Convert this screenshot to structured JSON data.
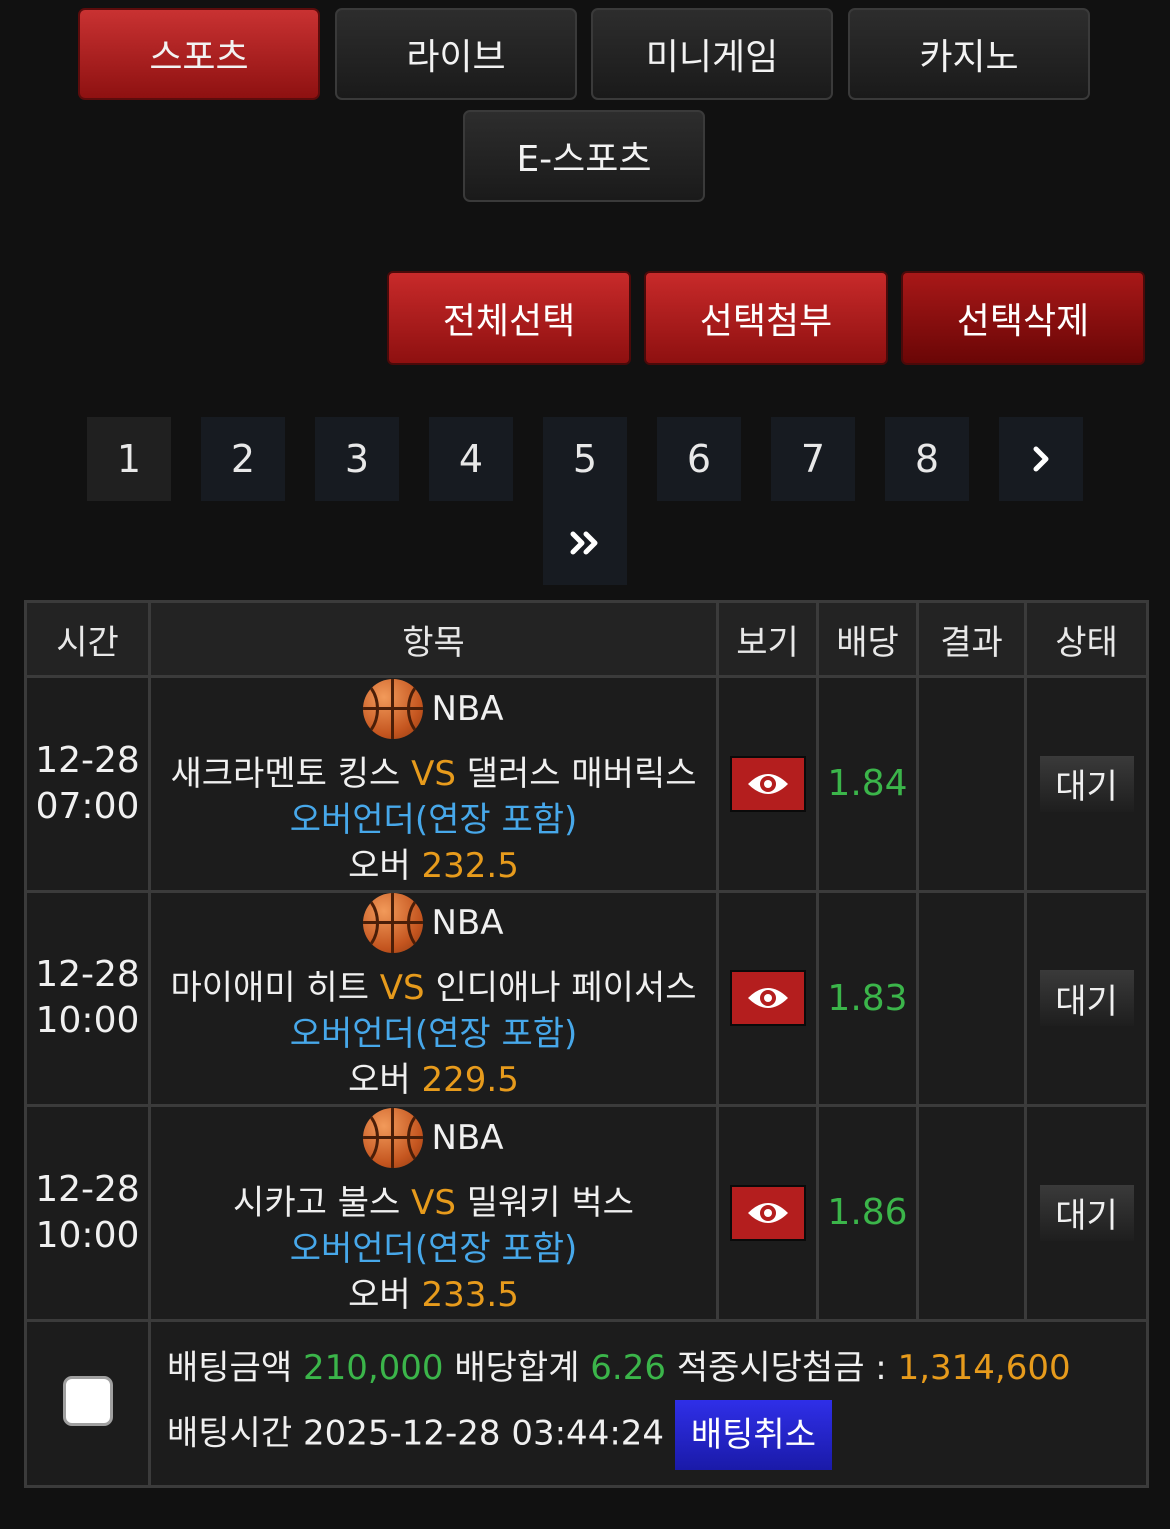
{
  "tabs": [
    {
      "label": "스포츠",
      "active": true
    },
    {
      "label": "라이브",
      "active": false
    },
    {
      "label": "미니게임",
      "active": false
    },
    {
      "label": "카지노",
      "active": false
    },
    {
      "label": "E-스포츠",
      "active": false
    }
  ],
  "actions": {
    "select_all": "전체선택",
    "attach_selected": "선택첨부",
    "delete_selected": "선택삭제"
  },
  "pagination": {
    "pages": [
      "1",
      "2",
      "3",
      "4",
      "5",
      "6",
      "7",
      "8"
    ],
    "current": "1",
    "next_icon": "chevron-right-icon",
    "last_icon": "double-chevron-right-icon"
  },
  "table": {
    "headers": {
      "time": "시간",
      "item": "항목",
      "view": "보기",
      "odds": "배당",
      "result": "결과",
      "status": "상태"
    },
    "rows": [
      {
        "date": "12-28",
        "time": "07:00",
        "league": "NBA",
        "home": "새크라멘토 킹스",
        "vs": "VS",
        "away": "댈러스 매버릭스",
        "market": "오버언더(연장 포함)",
        "pick": "오버",
        "line": "232.5",
        "odds": "1.84",
        "result": "",
        "status": "대기"
      },
      {
        "date": "12-28",
        "time": "10:00",
        "league": "NBA",
        "home": "마이애미 히트",
        "vs": "VS",
        "away": "인디애나 페이서스",
        "market": "오버언더(연장 포함)",
        "pick": "오버",
        "line": "229.5",
        "odds": "1.83",
        "result": "",
        "status": "대기"
      },
      {
        "date": "12-28",
        "time": "10:00",
        "league": "NBA",
        "home": "시카고 불스",
        "vs": "VS",
        "away": "밀워키 벅스",
        "market": "오버언더(연장 포함)",
        "pick": "오버",
        "line": "233.5",
        "odds": "1.86",
        "result": "",
        "status": "대기"
      }
    ]
  },
  "summary": {
    "bet_amount_label": "배팅금액",
    "bet_amount": "210,000",
    "odds_total_label": "배당합계",
    "odds_total": "6.26",
    "payout_label": "적중시당첨금 :",
    "payout": "1,314,600",
    "bet_time_label": "배팅시간",
    "bet_time": "2025-12-28 03:44:24",
    "cancel_label": "배팅취소"
  },
  "colors": {
    "accent_red": "#b41e1e",
    "odds_green": "#3bb54a",
    "value_orange": "#e79b1c",
    "market_blue": "#47a8ea",
    "cancel_blue": "#2f2fe8"
  }
}
